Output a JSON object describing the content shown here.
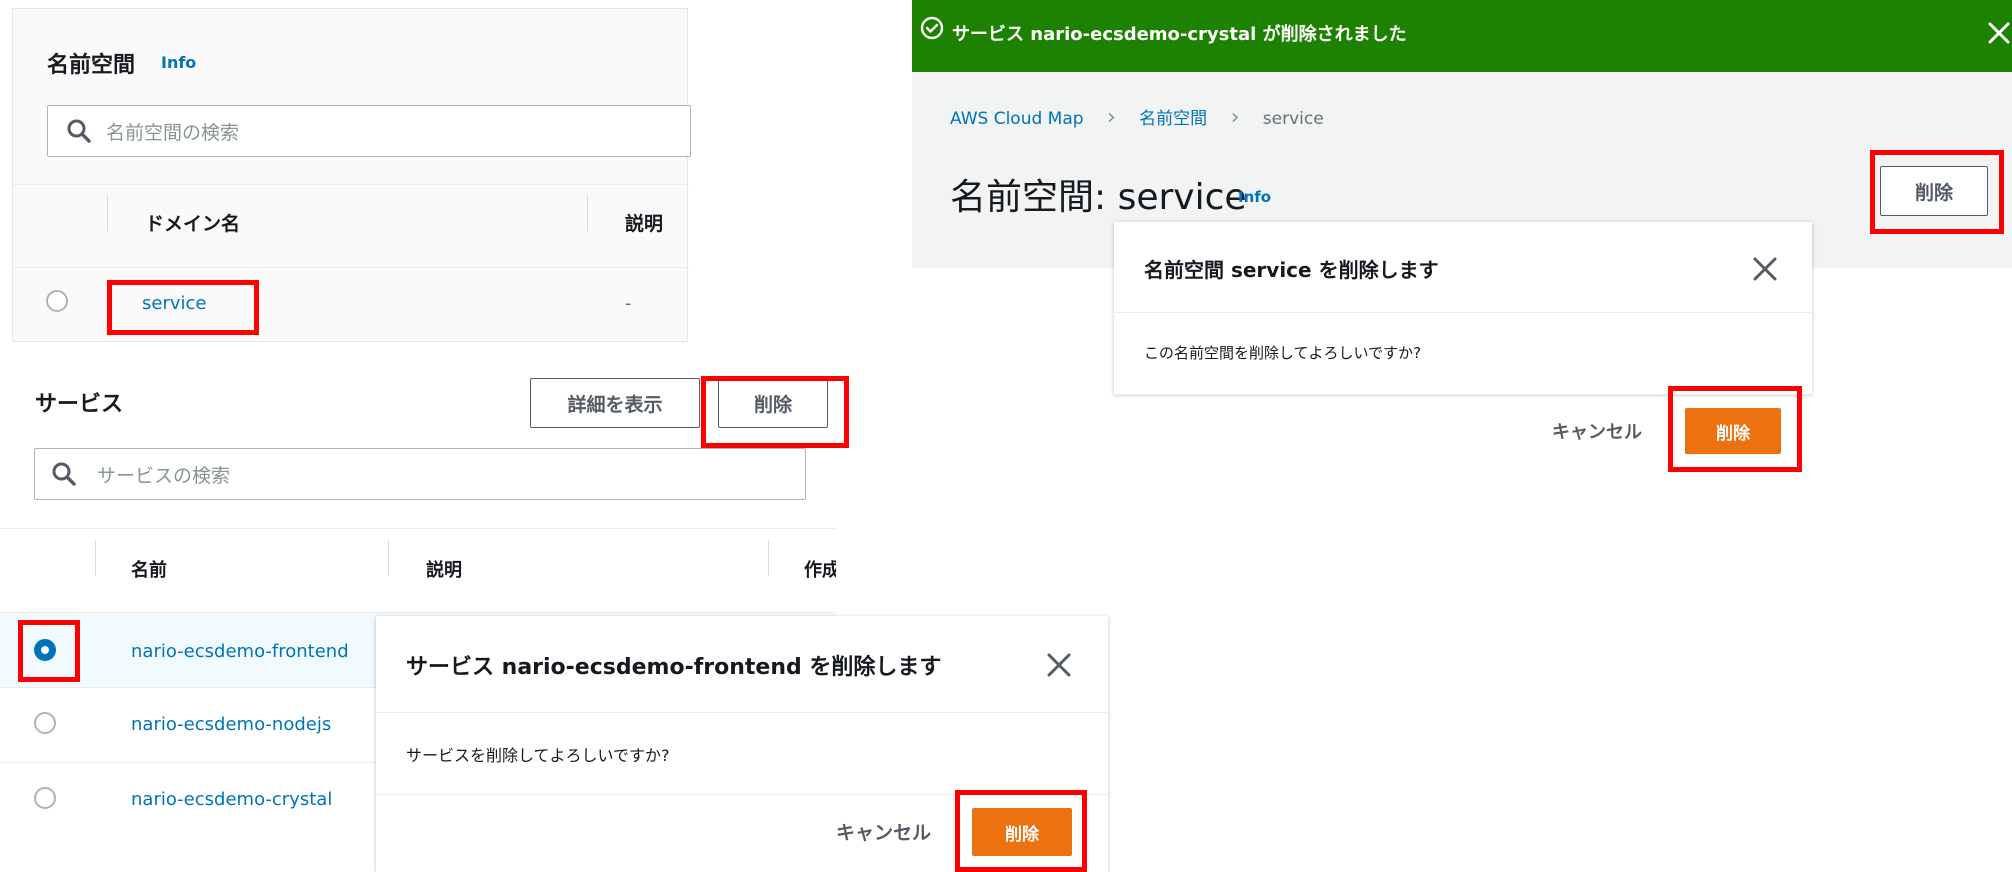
{
  "namespaces": {
    "title": "名前空間",
    "info": "Info",
    "search_placeholder": "名前空間の検索",
    "columns": [
      "ドメイン名",
      "説明"
    ],
    "rows": [
      {
        "name": "service",
        "description": "-"
      }
    ]
  },
  "services": {
    "title": "サービス",
    "view_details_label": "詳細を表示",
    "delete_label": "削除",
    "search_placeholder": "サービスの検索",
    "columns": [
      "名前",
      "説明",
      "作成"
    ],
    "rows": [
      {
        "name": "nario-ecsdemo-frontend",
        "selected": true
      },
      {
        "name": "nario-ecsdemo-nodejs",
        "selected": false
      },
      {
        "name": "nario-ecsdemo-crystal",
        "selected": false
      }
    ]
  },
  "service_delete_modal": {
    "title": "サービス nario-ecsdemo-frontend を削除します",
    "body": "サービスを削除してよろしいですか?",
    "cancel_label": "キャンセル",
    "confirm_label": "削除"
  },
  "namespace_detail": {
    "flash_message": "サービス nario-ecsdemo-crystal が削除されました",
    "breadcrumb": [
      "AWS Cloud Map",
      "名前空間",
      "service"
    ],
    "title": "名前空間: service",
    "info": "Info",
    "delete_label": "削除"
  },
  "namespace_delete_modal": {
    "title": "名前空間 service を削除します",
    "body": "この名前空間を削除してよろしいですか?",
    "cancel_label": "キャンセル",
    "confirm_label": "削除"
  },
  "colors": {
    "link": "#0073bb",
    "primary": "#ec7211",
    "success": "#1d8102",
    "highlight": "#ff0000"
  }
}
